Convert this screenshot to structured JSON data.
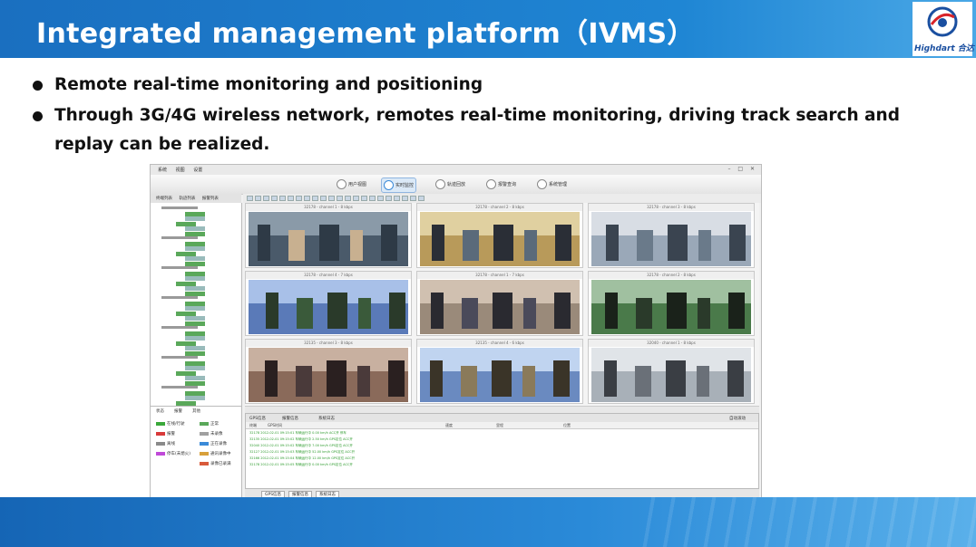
{
  "slide": {
    "title": "Integrated management platform（IVMS）",
    "logo_text": "Highdart 合达",
    "bullets": [
      "Remote real-time monitoring and positioning",
      "Through 3G/4G wireless network, remotes real-time monitoring, driving track search and replay can be realized."
    ]
  },
  "colors": {
    "header_blue": "#1f86d4",
    "footer_blue": "#2a8ad8",
    "logo_red": "#d8242a",
    "logo_blue": "#1a4fa0",
    "gps_text_green": "#2b9a2b"
  },
  "app": {
    "menu": [
      "系统",
      "视图",
      "设置"
    ],
    "modules": [
      {
        "label": "用户视图",
        "icon": "users-icon"
      },
      {
        "label": "实时监控",
        "icon": "monitor-icon",
        "active": true
      },
      {
        "label": "轨迹回放",
        "icon": "track-icon"
      },
      {
        "label": "报警查询",
        "icon": "alarm-icon"
      },
      {
        "label": "系统管理",
        "icon": "settings-icon"
      }
    ],
    "left_tabs": [
      "终端列表",
      "轨迹列表",
      "报警列表"
    ],
    "legend_tabs": [
      "状态",
      "报警",
      "其他"
    ],
    "legend": [
      {
        "label": "在线/行驶",
        "color": "#3aa83a"
      },
      {
        "label": "报警",
        "color": "#d83a3a"
      },
      {
        "label": "离线",
        "color": "#8a8a8a"
      },
      {
        "label": "停车(未熄火)",
        "color": "#c04ad8"
      },
      {
        "label": "正常",
        "color": "#5aa85a"
      },
      {
        "label": "未录像",
        "color": "#a0a0a0"
      },
      {
        "label": "正在录像",
        "color": "#3a8ad8"
      },
      {
        "label": "通讯录像中",
        "color": "#d8a03a"
      },
      {
        "label": "录像已录满",
        "color": "#d85a3a"
      }
    ],
    "video_channels": [
      "32178 - channel 1 - 8 kbps",
      "32178 - channel 2 - 8 kbps",
      "32178 - channel 3 - 8 kbps",
      "32178 - channel 4 - 7 kbps",
      "32178 - channel 1 - 7 kbps",
      "32178 - channel 2 - 8 kbps",
      "32135 - channel 3 - 8 kbps",
      "32135 - channel 4 - 6 kbps",
      "32040 - channel 1 - 8 kbps"
    ],
    "table_tabs": [
      "GPS信息",
      "报警信息",
      "系统日志"
    ],
    "table_columns": [
      "终端",
      "GPS时间",
      "速度",
      "里程",
      "位置"
    ],
    "auto_scroll_label": "自动滚动",
    "gps_rows": [
      "32178  2012-02-01 09:15:01  车辆运行中  0.00 km/h  ACC开 停车",
      "32135  2012-02-01 09:15:02  车辆运行中  2.50 km/h  GPS定位 ACC开",
      "32040  2012-02-01 09:15:02  车辆运行中  7.00 km/h  GPS定位 ACC开",
      "32127  2012-02-01 09:15:03  车辆运行中  52.00 km/h  GPS定位 ACC开",
      "32166  2012-02-01 09:15:04  车辆运行中  12.00 km/h  GPS定位 ACC开",
      "32178  2012-02-01 09:15:05  车辆运行中  0.00 km/h  GPS定位 ACC开"
    ]
  }
}
